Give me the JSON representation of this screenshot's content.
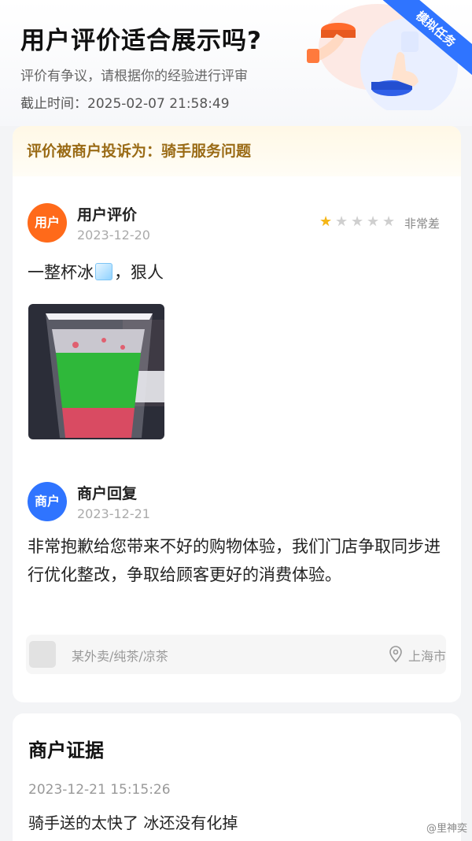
{
  "header": {
    "title": "用户评价适合展示吗?",
    "subtitle": "评价有争议，请根据你的经验进行评审",
    "deadline": "截止时间：2025-02-07 21:58:49",
    "ribbon": "模拟任务"
  },
  "complaint": {
    "text": "评价被商户投诉为：骑手服务问题"
  },
  "user_review": {
    "avatar_label": "用户",
    "name": "用户评价",
    "date": "2023-12-20",
    "rating": 1,
    "rating_max": 5,
    "rating_text": "非常差",
    "text_before": "一整杯冰",
    "text_after": "，狠人"
  },
  "merchant_reply": {
    "avatar_label": "商户",
    "name": "商户回复",
    "date": "2023-12-21",
    "text": "非常抱歉给您带来不好的购物体验，我们门店争取同步进行优化整改，争取给顾客更好的消费体验。"
  },
  "store": {
    "name": "某外卖/纯茶/凉茶",
    "city": "上海市"
  },
  "evidence": {
    "title": "商户证据",
    "time": "2023-12-21 15:15:26",
    "text": "骑手送的太快了 冰还没有化掉"
  },
  "watermark": "@里神奕",
  "colors": {
    "user_avatar": "#ff6a1a",
    "shop_avatar": "#2f74ff",
    "star_on": "#f5b616",
    "complaint_text": "#9a6b16"
  }
}
